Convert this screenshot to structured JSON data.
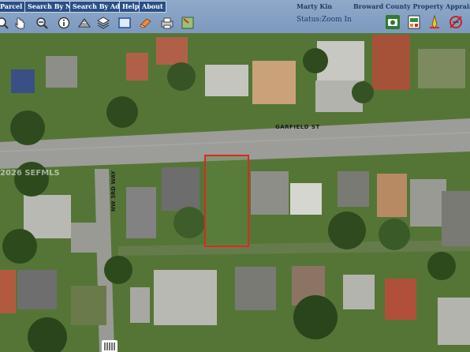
{
  "nav": {
    "items": [
      {
        "label": "Parcel Id"
      },
      {
        "label": "Search By Name"
      },
      {
        "label": "Search By Address"
      },
      {
        "label": "Help"
      },
      {
        "label": "About"
      }
    ]
  },
  "header": {
    "user": "Marty Kin",
    "organization": "Broward County Property Apprais",
    "status_label": "Status:",
    "status_value": "Zoom In"
  },
  "tools": {
    "left": [
      "zoom-in-icon",
      "pan-icon",
      "info-icon",
      "parcel-icon",
      "layers-icon",
      "full-extent-icon",
      "eraser-icon",
      "print-icon",
      "select-map-icon"
    ],
    "right": [
      "camera-icon",
      "export-icon",
      "measure-icon",
      "clear-icon"
    ]
  },
  "map": {
    "street_main": "GARFIELD ST",
    "street_side": "NW 3RD WAY",
    "watermark": "2026 SEFMLS",
    "highlight_color": "#d82a1e"
  }
}
